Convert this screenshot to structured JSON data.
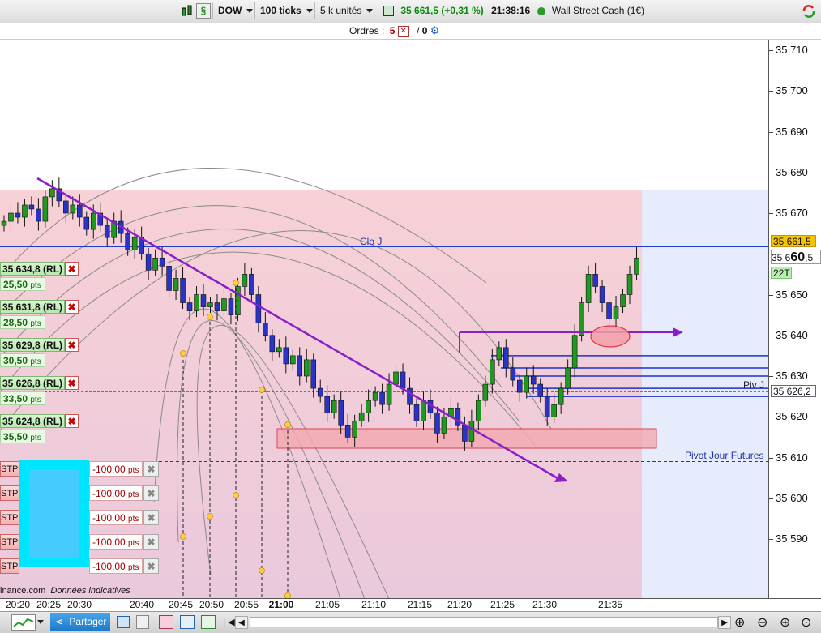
{
  "toolbar": {
    "symbol": "DOW",
    "ticks": "100 ticks",
    "units": "5 k unités",
    "price": "35 661,5 (+0,31 %)",
    "time": "21:38:16",
    "instrument": "Wall Street Cash (1€)"
  },
  "orders": {
    "label": "Ordres :",
    "count_a": "5",
    "sep": "/",
    "count_b": "0"
  },
  "chart_data": {
    "type": "candlestick",
    "ylim": [
      35578,
      35715
    ],
    "y_ticks": [
      "35 710",
      "35 700",
      "35 690",
      "35 680",
      "35 670",
      "35 660",
      "35 650",
      "35 640",
      "35 630",
      "35 620",
      "35 610",
      "35 600",
      "35 590"
    ],
    "x_ticks": [
      "20:20",
      "20:25",
      "20:30",
      "20:40",
      "20:45",
      "20:50",
      "20:55",
      "21:00",
      "21:05",
      "21:10",
      "21:15",
      "21:20",
      "21:25",
      "21:30",
      "21:35"
    ],
    "close": [
      35668,
      35670,
      35669,
      35672,
      35671,
      35668,
      35674,
      35676,
      35673,
      35670,
      35672,
      35669,
      35666,
      35670,
      35667,
      35664,
      35668,
      35665,
      35661,
      35664,
      35660,
      35656,
      35659,
      35657,
      35651,
      35654,
      35648,
      35646,
      35650,
      35647,
      35648,
      35646,
      35649,
      35645,
      35652,
      35655,
      35650,
      35643,
      35640,
      35636,
      35637,
      35633,
      35635,
      35630,
      35634,
      35627,
      35625,
      35621,
      35624,
      35618,
      35615,
      35619,
      35621,
      35624,
      35626,
      35623,
      35628,
      35631,
      35627,
      35623,
      35619,
      35624,
      35621,
      35616,
      35620,
      35622,
      35618,
      35614,
      35619,
      35624,
      35628,
      35634,
      35637,
      35632,
      35629,
      35626,
      35630,
      35628,
      35625,
      35620,
      35623,
      35627,
      35632,
      35640,
      35648,
      35655,
      35652,
      35648,
      35644,
      35647,
      35650,
      35655,
      35659
    ],
    "lines": [
      {
        "label": "Clo J",
        "value": 35661.8
      },
      {
        "label": "Piv J",
        "value": 35626.2
      },
      {
        "label": "Pivot Jour Futures",
        "value": 35609
      }
    ],
    "price_labels": {
      "last": "35 661,5",
      "cursor_a": "35 6",
      "cursor_b": "60",
      "cursor_c": ",5",
      "ticks": "22T",
      "pivot": "35 626,2"
    },
    "source": "inance.com",
    "source_note": "Données indicatives"
  },
  "orders_list": [
    {
      "price": "35 634,8 (RL)",
      "pts": "25,50"
    },
    {
      "price": "35 631,8 (RL)",
      "pts": "28,50"
    },
    {
      "price": "35 629,8 (RL)",
      "pts": "30,50"
    },
    {
      "price": "35 626,8 (RL)",
      "pts": "33,50"
    },
    {
      "price": "35 624,8 (RL)",
      "pts": "35,50"
    }
  ],
  "stop_list": [
    {
      "label": "STP",
      "value": "-100,00"
    },
    {
      "label": "STP",
      "value": "-100,00"
    },
    {
      "label": "STP",
      "value": "-100,00"
    },
    {
      "label": "STP",
      "value": "-100,00"
    },
    {
      "label": "STP",
      "value": "-100,00"
    }
  ],
  "pts_unit": "pts",
  "bottombar": {
    "share": "Partager"
  }
}
